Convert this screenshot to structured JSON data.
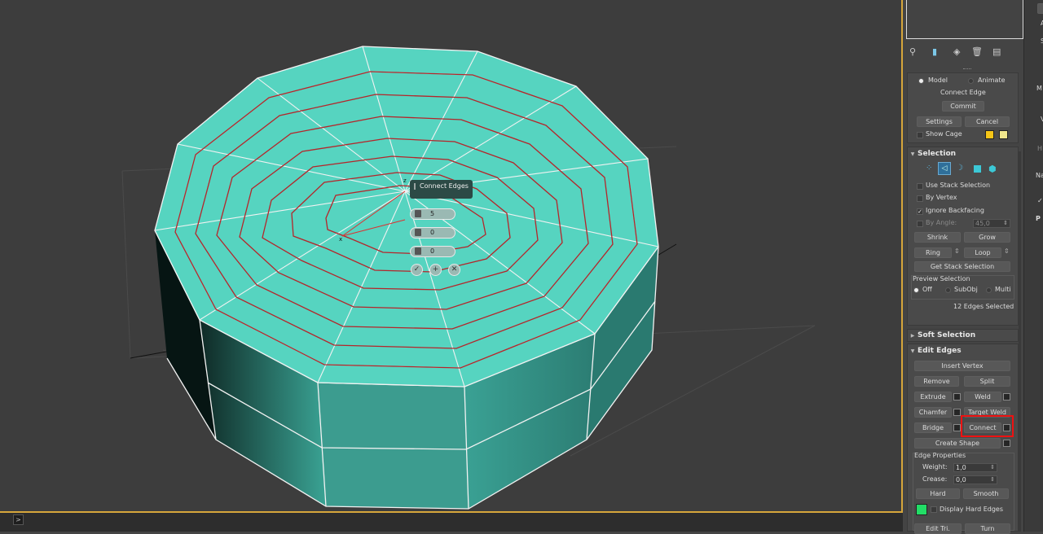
{
  "viewport": {
    "caddy": {
      "title": "Connect Edges",
      "segments": "5",
      "pinch": "0",
      "slide": "0",
      "ok_icon": "check-icon",
      "apply_icon": "plus-icon",
      "cancel_icon": "x-icon"
    },
    "gizmo_label": "z",
    "gizmo_label2": "x"
  },
  "bottom_bar": {
    "arrow": ">"
  },
  "toolbar": {
    "icons": [
      "pin-icon",
      "stack-icon",
      "modifier-icon",
      "trash-icon",
      "configure-icon"
    ]
  },
  "connect_edge": {
    "model": "Model",
    "animate": "Animate",
    "title": "Connect Edge",
    "commit": "Commit",
    "settings": "Settings",
    "cancel": "Cancel",
    "show_cage": "Show Cage",
    "cage_color_1": "#f5c518",
    "cage_color_2": "#f0e68c"
  },
  "selection": {
    "title": "Selection",
    "use_stack_selection": "Use Stack Selection",
    "by_vertex": "By Vertex",
    "ignore_backfacing": "Ignore Backfacing",
    "by_angle": "By Angle:",
    "by_angle_value": "45,0",
    "shrink": "Shrink",
    "grow": "Grow",
    "ring": "Ring",
    "loop": "Loop",
    "get_stack_selection": "Get Stack Selection",
    "preview_selection": "Preview Selection",
    "off": "Off",
    "subobj": "SubObj",
    "multi": "Multi",
    "status": "12 Edges Selected"
  },
  "soft_selection": {
    "title": "Soft Selection"
  },
  "edit_edges": {
    "title": "Edit Edges",
    "insert_vertex": "Insert Vertex",
    "remove": "Remove",
    "split": "Split",
    "extrude": "Extrude",
    "weld": "Weld",
    "chamfer": "Chamfer",
    "target_weld": "Target Weld",
    "bridge": "Bridge",
    "connect": "Connect",
    "create_shape": "Create Shape",
    "edge_properties": "Edge Properties",
    "weight_label": "Weight:",
    "weight_value": "1,0",
    "crease_label": "Crease:",
    "crease_value": "0,0",
    "hard": "Hard",
    "smooth": "Smooth",
    "display_hard_edges": "Display Hard Edges",
    "hard_edge_color": "#22dd66",
    "edit_tri": "Edit Tri.",
    "turn": "Turn"
  },
  "far_panel": {
    "items": [
      "A",
      "S",
      "M",
      "V",
      "H",
      "Na",
      "P"
    ]
  }
}
